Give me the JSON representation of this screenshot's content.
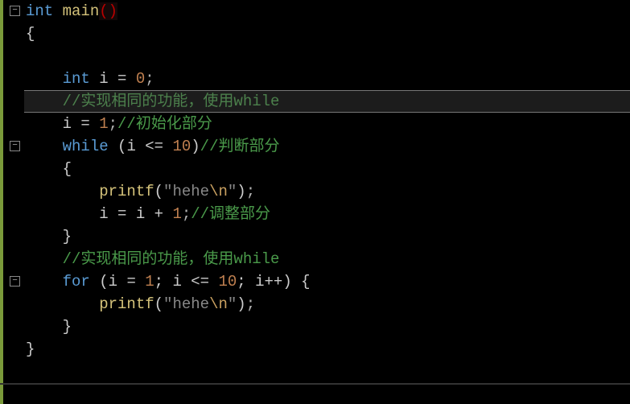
{
  "code": {
    "l1_kw": "int",
    "l1_fn": "main",
    "l1_paren": "()",
    "l2_brace": "{",
    "l3_empty": "",
    "l4_kw": "int",
    "l4_id": " i = ",
    "l4_num": "0",
    "l4_semi": ";",
    "l5_cmt": "//实现相同的功能，使用while",
    "l6_lhs": "i = ",
    "l6_num": "1",
    "l6_semi": ";",
    "l6_cmt": "//初始化部分",
    "l7_kw": "while",
    "l7_open": " (",
    "l7_expr": "i <= ",
    "l7_num": "10",
    "l7_close": ")",
    "l7_cmt": "//判断部分",
    "l8_brace": "{",
    "l9_fn": "printf",
    "l9_open": "(",
    "l9_str1": "\"hehe",
    "l9_esc": "\\n",
    "l9_str2": "\"",
    "l9_close": ")",
    "l9_semi": ";",
    "l10_lhs": "i = i + ",
    "l10_num": "1",
    "l10_semi": ";",
    "l10_cmt": "//调整部分",
    "l11_brace": "}",
    "l12_cmt": "//实现相同的功能，使用while",
    "l13_kw": "for",
    "l13_open": " (",
    "l13_p1": "i = ",
    "l13_n1": "1",
    "l13_p2": "; i <= ",
    "l13_n2": "10",
    "l13_p3": "; i++",
    "l13_close": ")",
    "l13_brace": " {",
    "l14_fn": "printf",
    "l14_open": "(",
    "l14_str1": "\"hehe",
    "l14_esc": "\\n",
    "l14_str2": "\"",
    "l14_close": ")",
    "l14_semi": ";",
    "l15_brace": "}",
    "l16_brace": "}"
  }
}
